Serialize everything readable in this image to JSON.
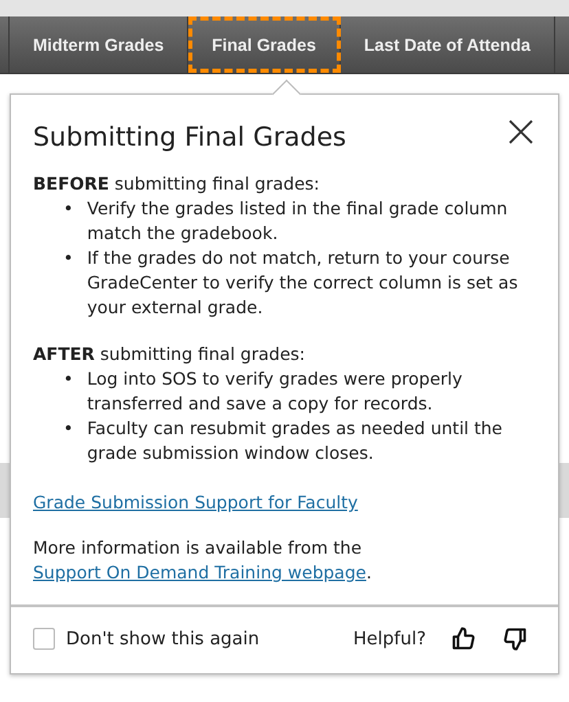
{
  "tabs": [
    {
      "label": "Midterm Grades",
      "focused": false
    },
    {
      "label": "Final Grades",
      "focused": true
    },
    {
      "label": "Last Date of Attenda",
      "focused": false
    }
  ],
  "popover": {
    "title": "Submitting Final Grades",
    "sections": [
      {
        "lead": "**BEFORE** submitting final grades:",
        "bullets": [
          {
            "marker": "•",
            "text": "Verify the grades listed in the final grade column match the gradebook."
          },
          {
            "marker": "•",
            "text": "If the grades do not match, return to your course GradeCenter to verify the correct column is set as your external grade."
          }
        ]
      },
      {
        "lead": "**AFTER** submitting final grades:",
        "bullets": [
          {
            "marker": "•",
            "text": "Log into SOS to verify grades were properly transferred and save a copy for records."
          },
          {
            "marker": "•",
            "text": "Faculty can resubmit grades as needed until the grade submission window closes."
          }
        ]
      }
    ],
    "support_link": "Grade Submission Support for Faculty",
    "more_info": {
      "text": "More information is available from the",
      "link": "Support On Demand Training webpage",
      "end": "."
    },
    "footer": {
      "checkbox_label": "Don't show this again",
      "checked": false,
      "helpful_label": "Helpful?"
    }
  }
}
